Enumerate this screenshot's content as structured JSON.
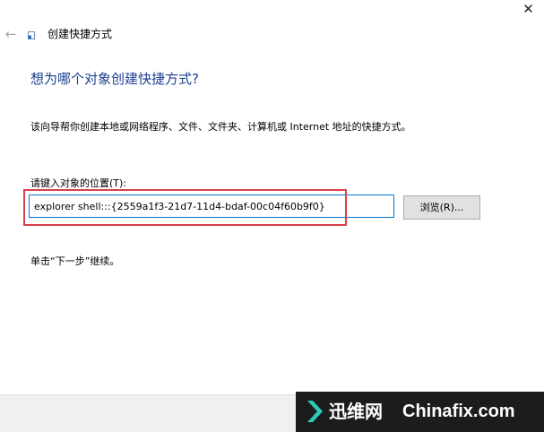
{
  "window": {
    "title": "创建快捷方式",
    "close_glyph": "✕",
    "back_glyph": "←"
  },
  "icons": {
    "back": "back-arrow-icon",
    "title": "shortcut-icon",
    "close": "close-icon",
    "watermark_logo": "chevron-logo-icon"
  },
  "main": {
    "heading": "想为哪个对象创建快捷方式?",
    "description": "该向导帮你创建本地或网络程序、文件、文件夹、计算机或 Internet 地址的快捷方式。",
    "location_label": "请键入对象的位置(T):",
    "location_value": "explorer shell:::{2559a1f3-21d7-11d4-bdaf-00c04f60b9f0}",
    "browse_label": "浏览(R)...",
    "next_hint": "单击“下一步”继续。"
  },
  "watermark": {
    "brand_cn": "迅维网",
    "brand_en": "Chinafix.com"
  },
  "colors": {
    "heading": "#1e3f8f",
    "input_border": "#0078d7",
    "highlight": "#d9404a",
    "watermark_bg": "#1c1c1c",
    "watermark_accent": "#2ec9b8"
  }
}
